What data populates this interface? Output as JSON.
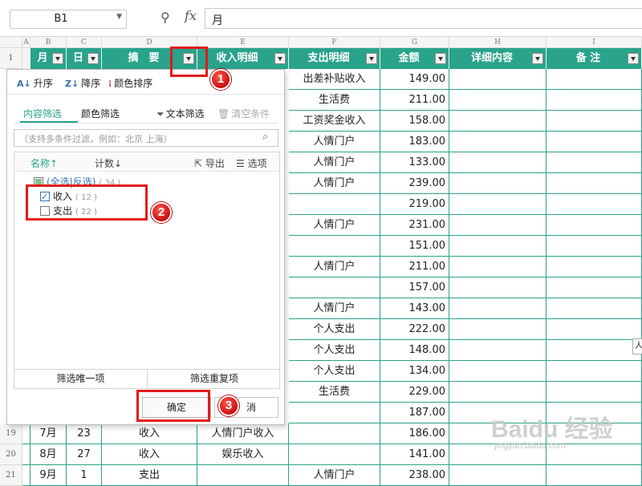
{
  "formula_bar": {
    "name_box": "B1",
    "fx_label": "fx",
    "formula_value": "月"
  },
  "columns": [
    "A",
    "B",
    "C",
    "D",
    "E",
    "F",
    "G",
    "H",
    "I"
  ],
  "row_numbers": [
    "1",
    "19",
    "20",
    "21"
  ],
  "headers": [
    "月",
    "日",
    "摘　要",
    "收入明细",
    "支出明细",
    "金额",
    "详细内容",
    "备 注"
  ],
  "col_f_values": [
    "出差补贴收入",
    "生活费",
    "工资奖金收入",
    "人情门户",
    "人情门户",
    "人情门户",
    "",
    "人情门户",
    "",
    "人情门户",
    "",
    "人情门户",
    "个人支出",
    "个人支出",
    "个人支出",
    "生活费",
    "",
    "",
    "",
    "人情门户"
  ],
  "col_g_values": [
    "149.00",
    "211.00",
    "158.00",
    "183.00",
    "133.00",
    "239.00",
    "219.00",
    "231.00",
    "151.00",
    "211.00",
    "157.00",
    "143.00",
    "222.00",
    "148.00",
    "134.00",
    "229.00",
    "187.00",
    "186.00",
    "141.00",
    "238.00"
  ],
  "bottom_rows": [
    {
      "month": "7月",
      "day": "23",
      "summary": "收入",
      "income": "人情门户收入",
      "expense": ""
    },
    {
      "month": "8月",
      "day": "27",
      "summary": "收入",
      "income": "娱乐收入",
      "expense": ""
    },
    {
      "month": "9月",
      "day": "1",
      "summary": "支出",
      "income": "",
      "expense": "人情门户"
    }
  ],
  "filter_panel": {
    "sort_asc": "升序",
    "sort_desc": "降序",
    "sort_color": "颜色排序",
    "tab_content": "内容筛选",
    "tab_color": "颜色筛选",
    "text_filter": "文本筛选",
    "clear_conditions": "清空条件",
    "search_placeholder": "（支持多条件过滤，例如：北京 上海）",
    "col_name": "名称↑",
    "col_count": "计数↓",
    "export": "导出",
    "options": "选项",
    "select_all": "(全选|反选)",
    "select_all_count": "( 34 )",
    "items": [
      {
        "label": "收入",
        "count": "( 12 )",
        "checked": true
      },
      {
        "label": "支出",
        "count": "( 22 )",
        "checked": false
      }
    ],
    "btn_unique": "筛选唯一项",
    "btn_dup": "筛选重复项",
    "ok": "确定",
    "cancel": "消"
  },
  "annotations": [
    "1",
    "2",
    "3"
  ],
  "watermark": "Baidu 经验",
  "watermark_url": "jingyan.baidu.com",
  "edge_tip": "人"
}
